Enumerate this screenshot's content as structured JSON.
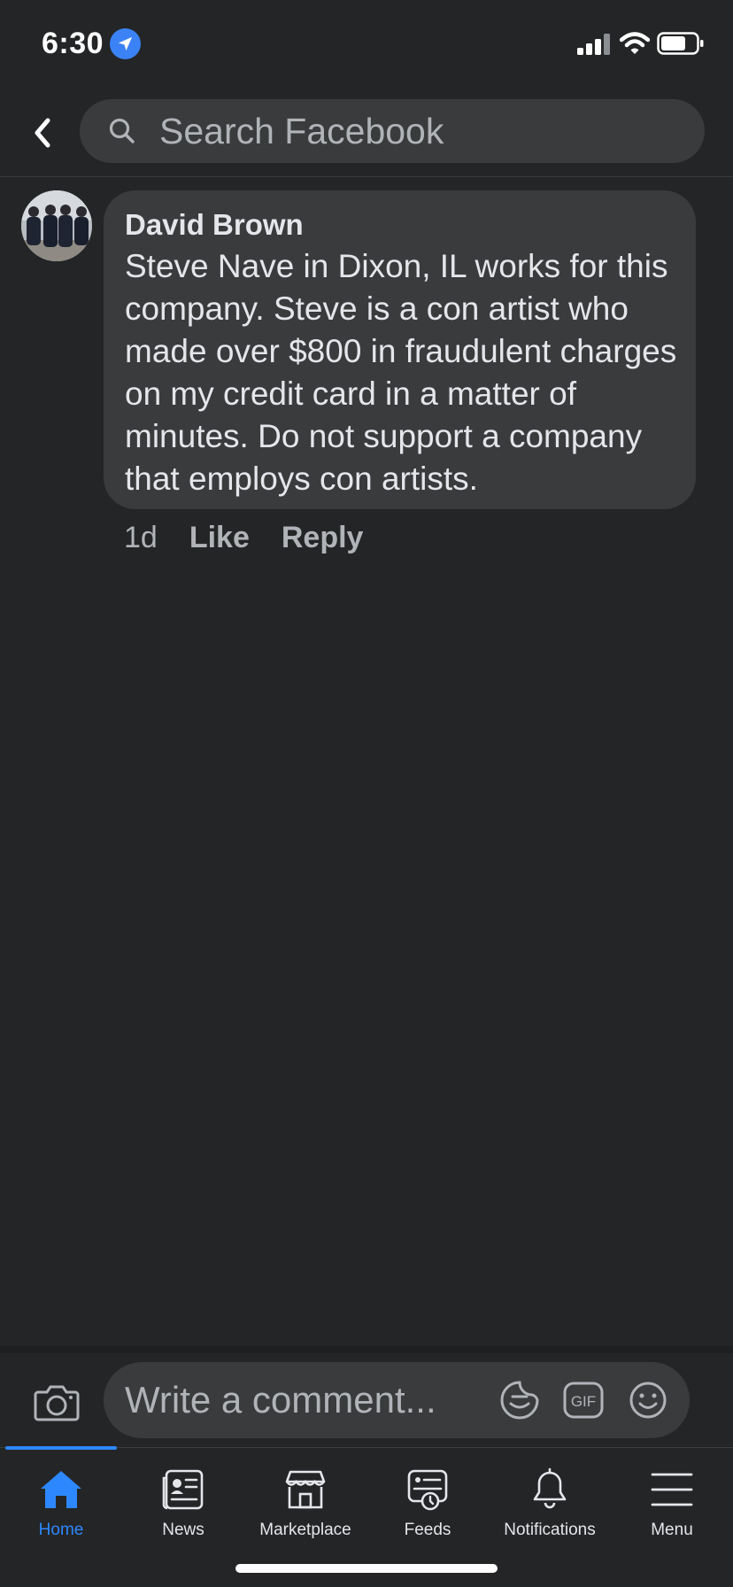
{
  "status_bar": {
    "time": "6:30",
    "icons": [
      "location-arrow-icon",
      "signal-icon",
      "wifi-icon",
      "battery-icon"
    ]
  },
  "header": {
    "search_placeholder": "Search Facebook",
    "icons": [
      "back-arrow-icon",
      "search-icon"
    ]
  },
  "comment": {
    "author": "David Brown",
    "text": "Steve Nave in Dixon, IL works for this company. Steve is a con artist who made over $800 in fraudulent charges on my credit card in a matter of minutes. Do not support a company that employs con artists.",
    "time": "1d",
    "like_label": "Like",
    "reply_label": "Reply"
  },
  "composer": {
    "placeholder": "Write a comment...",
    "icons": [
      "camera-icon",
      "sticker-icon",
      "gif-icon",
      "emoji-icon"
    ]
  },
  "tabs": [
    {
      "label": "Home",
      "icon": "home-icon",
      "active": true
    },
    {
      "label": "News",
      "icon": "news-icon",
      "active": false
    },
    {
      "label": "Marketplace",
      "icon": "marketplace-icon",
      "active": false
    },
    {
      "label": "Feeds",
      "icon": "feeds-icon",
      "active": false
    },
    {
      "label": "Notifications",
      "icon": "bell-icon",
      "active": false
    },
    {
      "label": "Menu",
      "icon": "menu-icon",
      "active": false
    }
  ],
  "colors": {
    "background": "#242526",
    "bubble": "#3a3b3c",
    "accent": "#2d88ff",
    "secondary_text": "#b0b3b8"
  }
}
